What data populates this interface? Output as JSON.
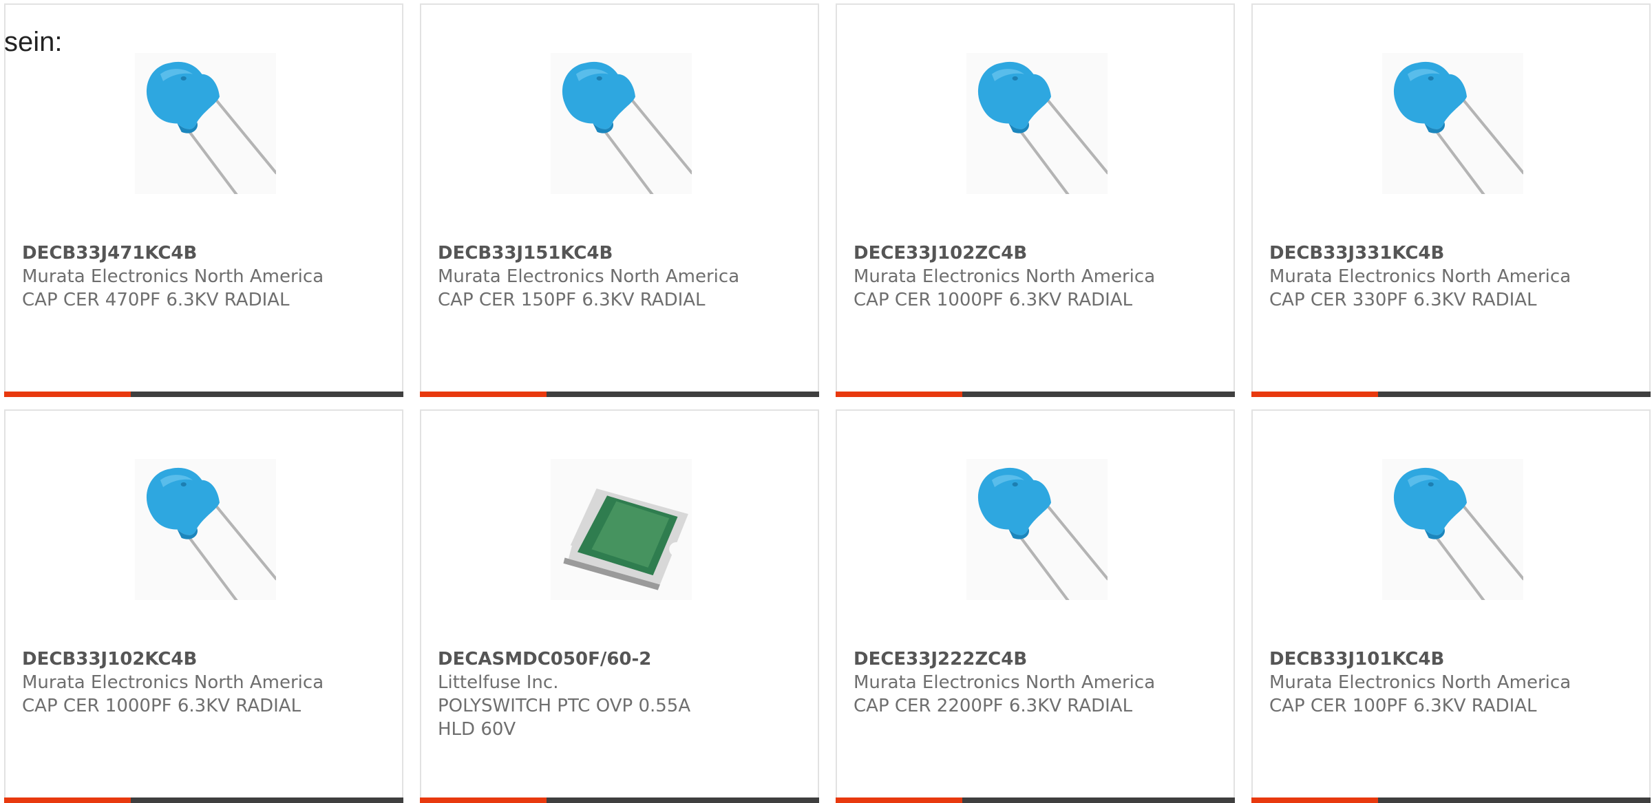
{
  "intro_text": "sein:",
  "accent_color": "#e8390e",
  "bar_color": "#3f3f3f",
  "products": [
    {
      "part_number": "DECB33J471KC4B",
      "manufacturer": "Murata Electronics North America",
      "description": "CAP CER 470PF 6.3KV RADIAL",
      "image": "ceramic-disc-capacitor-icon"
    },
    {
      "part_number": "DECB33J151KC4B",
      "manufacturer": "Murata Electronics North America",
      "description": "CAP CER 150PF 6.3KV RADIAL",
      "image": "ceramic-disc-capacitor-icon"
    },
    {
      "part_number": "DECE33J102ZC4B",
      "manufacturer": "Murata Electronics North America",
      "description": "CAP CER 1000PF 6.3KV RADIAL",
      "image": "ceramic-disc-capacitor-icon"
    },
    {
      "part_number": "DECB33J331KC4B",
      "manufacturer": "Murata Electronics North America",
      "description": "CAP CER 330PF 6.3KV RADIAL",
      "image": "ceramic-disc-capacitor-icon"
    },
    {
      "part_number": "DECB33J102KC4B",
      "manufacturer": "Murata Electronics North America",
      "description": "CAP CER 1000PF 6.3KV RADIAL",
      "image": "ceramic-disc-capacitor-icon"
    },
    {
      "part_number": "DECASMDC050F/60-2",
      "manufacturer": "Littelfuse Inc.",
      "description": "POLYSWITCH PTC OVP 0.55A HLD 60V",
      "image": "smd-ptc-fuse-icon"
    },
    {
      "part_number": "DECE33J222ZC4B",
      "manufacturer": "Murata Electronics North America",
      "description": "CAP CER 2200PF 6.3KV RADIAL",
      "image": "ceramic-disc-capacitor-icon"
    },
    {
      "part_number": "DECB33J101KC4B",
      "manufacturer": "Murata Electronics North America",
      "description": "CAP CER 100PF 6.3KV RADIAL",
      "image": "ceramic-disc-capacitor-icon"
    }
  ]
}
